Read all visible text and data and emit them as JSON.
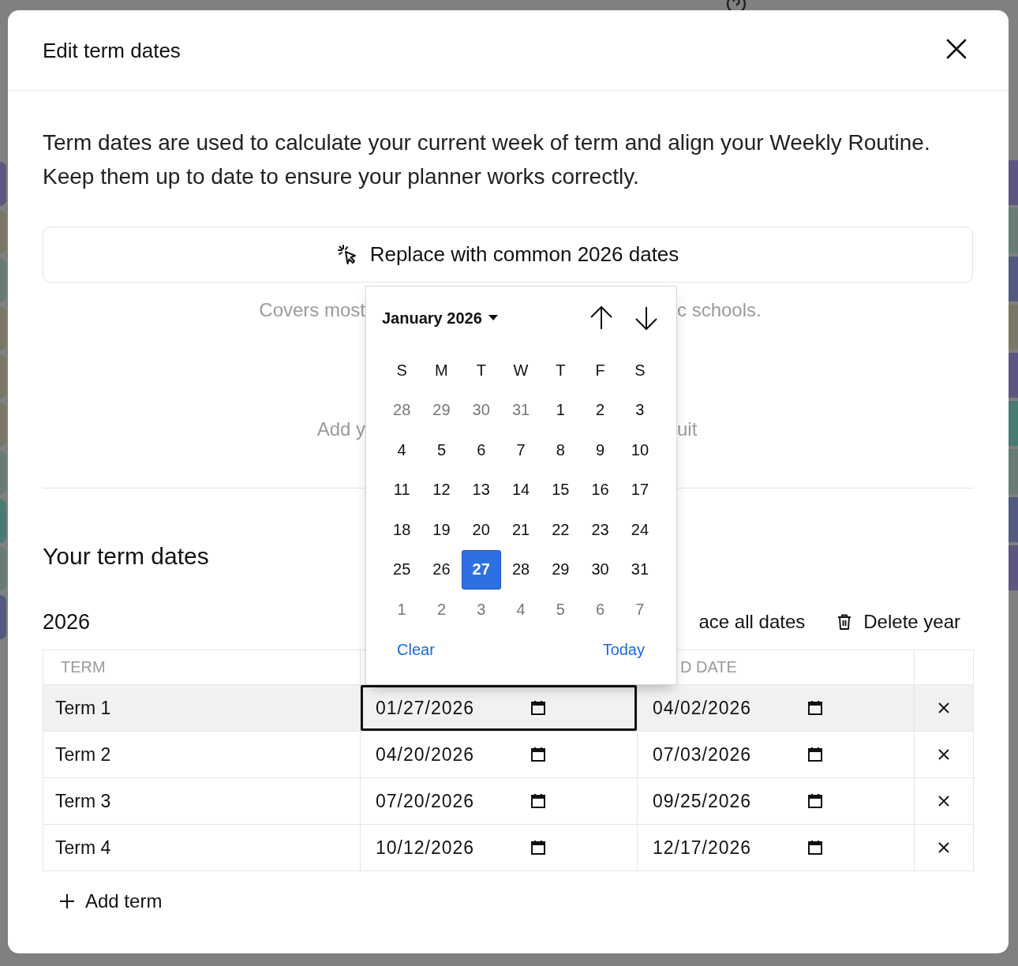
{
  "dialog": {
    "title": "Edit term dates",
    "description": "Term dates are used to calculate your current week of term and align your Weekly Routine. Keep them up to date to ensure your planner works correctly.",
    "replace_button": "Replace with common 2026 dates",
    "covered_hints": [
      {
        "left": "Covers most",
        "right": "c schools."
      },
      {
        "left": "Add y",
        "right": "uit"
      }
    ],
    "section_title": "Your term dates",
    "year": "2026",
    "year_actions": [
      {
        "kind": "replace",
        "label": "ace all dates"
      },
      {
        "kind": "delete",
        "label": "Delete year"
      }
    ],
    "table": {
      "header": {
        "column_1": "TERM",
        "column_3": "D DATE"
      },
      "rows": [
        {
          "term": "Term 1",
          "start": "01/27/2026",
          "end": "04/02/2026",
          "highlighted": true,
          "start_focused": true
        },
        {
          "term": "Term 2",
          "start": "04/20/2026",
          "end": "07/03/2026",
          "highlighted": false,
          "start_focused": false
        },
        {
          "term": "Term 3",
          "start": "07/20/2026",
          "end": "09/25/2026",
          "highlighted": false,
          "start_focused": false
        },
        {
          "term": "Term 4",
          "start": "10/12/2026",
          "end": "12/17/2026",
          "highlighted": false,
          "start_focused": false
        }
      ]
    },
    "add_button": "Add term"
  },
  "date_picker": {
    "month": "January 2026",
    "weekdays": [
      "S",
      "M",
      "T",
      "W",
      "T",
      "F",
      "S"
    ],
    "weeks": [
      [
        {
          "day": "28",
          "outside": true,
          "selected": false
        },
        {
          "day": "29",
          "outside": true,
          "selected": false
        },
        {
          "day": "30",
          "outside": true,
          "selected": false
        },
        {
          "day": "31",
          "outside": true,
          "selected": false
        },
        {
          "day": "1",
          "outside": false,
          "selected": false
        },
        {
          "day": "2",
          "outside": false,
          "selected": false
        },
        {
          "day": "3",
          "outside": false,
          "selected": false
        }
      ],
      [
        {
          "day": "4",
          "outside": false,
          "selected": false
        },
        {
          "day": "5",
          "outside": false,
          "selected": false
        },
        {
          "day": "6",
          "outside": false,
          "selected": false
        },
        {
          "day": "7",
          "outside": false,
          "selected": false
        },
        {
          "day": "8",
          "outside": false,
          "selected": false
        },
        {
          "day": "9",
          "outside": false,
          "selected": false
        },
        {
          "day": "10",
          "outside": false,
          "selected": false
        }
      ],
      [
        {
          "day": "11",
          "outside": false,
          "selected": false
        },
        {
          "day": "12",
          "outside": false,
          "selected": false
        },
        {
          "day": "13",
          "outside": false,
          "selected": false
        },
        {
          "day": "14",
          "outside": false,
          "selected": false
        },
        {
          "day": "15",
          "outside": false,
          "selected": false
        },
        {
          "day": "16",
          "outside": false,
          "selected": false
        },
        {
          "day": "17",
          "outside": false,
          "selected": false
        }
      ],
      [
        {
          "day": "18",
          "outside": false,
          "selected": false
        },
        {
          "day": "19",
          "outside": false,
          "selected": false
        },
        {
          "day": "20",
          "outside": false,
          "selected": false
        },
        {
          "day": "21",
          "outside": false,
          "selected": false
        },
        {
          "day": "22",
          "outside": false,
          "selected": false
        },
        {
          "day": "23",
          "outside": false,
          "selected": false
        },
        {
          "day": "24",
          "outside": false,
          "selected": false
        }
      ],
      [
        {
          "day": "25",
          "outside": false,
          "selected": false
        },
        {
          "day": "26",
          "outside": false,
          "selected": false
        },
        {
          "day": "27",
          "outside": false,
          "selected": true
        },
        {
          "day": "28",
          "outside": false,
          "selected": false
        },
        {
          "day": "29",
          "outside": false,
          "selected": false
        },
        {
          "day": "30",
          "outside": false,
          "selected": false
        },
        {
          "day": "31",
          "outside": false,
          "selected": false
        }
      ],
      [
        {
          "day": "1",
          "outside": true,
          "selected": false
        },
        {
          "day": "2",
          "outside": true,
          "selected": false
        },
        {
          "day": "3",
          "outside": true,
          "selected": false
        },
        {
          "day": "4",
          "outside": true,
          "selected": false
        },
        {
          "day": "5",
          "outside": true,
          "selected": false
        },
        {
          "day": "6",
          "outside": true,
          "selected": false
        },
        {
          "day": "7",
          "outside": true,
          "selected": false
        }
      ]
    ],
    "clear": "Clear",
    "today": "Today"
  }
}
